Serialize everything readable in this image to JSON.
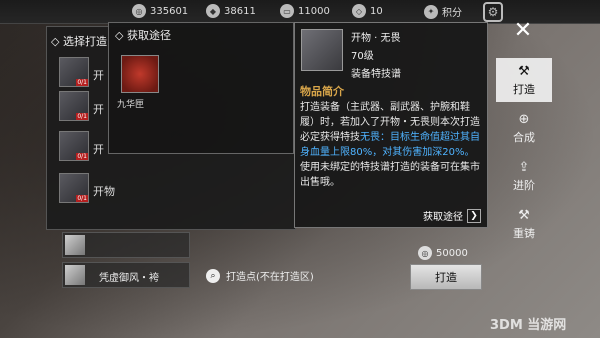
{
  "topbar": {
    "currencies": [
      {
        "icon": "coin-icon",
        "value": "335601"
      },
      {
        "icon": "silver-ingot-icon",
        "value": "38611"
      },
      {
        "icon": "ticket-icon",
        "value": "11000"
      },
      {
        "icon": "gem-icon",
        "value": "10"
      },
      {
        "icon": "points-icon",
        "value": "积分"
      }
    ]
  },
  "list_panel": {
    "title": "选择打造",
    "items": [
      {
        "text": "开",
        "tag": "0/1"
      },
      {
        "text": "开",
        "tag": "0/1"
      },
      {
        "text": "开",
        "tag": "0/1"
      },
      {
        "text": "开物",
        "tag": "0/1"
      }
    ]
  },
  "source_panel": {
    "title": "获取途径",
    "item_label": "九华匣"
  },
  "detail": {
    "name": "开物 · 无畏",
    "level": "70级",
    "type": "装备特技谱",
    "section_title": "物品简介",
    "desc_part1": "打造装备（主武器、副武器、护腕和鞋履）时，若加入了开物・无畏则本次打造必定获得特技",
    "desc_highlight": "无畏：目标生命值超过其自身血量上限80%，对其伤害加深20%。",
    "desc_part2": "使用未绑定的特技谱打造的装备可在集市出售哦。",
    "link": "获取途径"
  },
  "side_menu": [
    {
      "label": "打造",
      "icon": "anvil-icon",
      "active": true
    },
    {
      "label": "合成",
      "icon": "merge-icon",
      "active": false
    },
    {
      "label": "进阶",
      "icon": "upgrade-icon",
      "active": false
    },
    {
      "label": "重铸",
      "icon": "hammer-icon",
      "active": false
    }
  ],
  "bottom": {
    "row_item": "凭虚御风・袴",
    "forge_location": "打造点(不在打造区)",
    "cost": "50000",
    "forge_button": "打造"
  },
  "watermark": "3DM 当游网"
}
